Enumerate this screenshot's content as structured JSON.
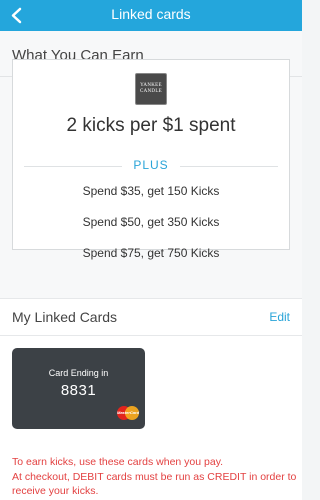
{
  "header": {
    "title": "Linked cards",
    "back_icon": "chevron-left-icon"
  },
  "earn": {
    "heading": "What You Can Earn",
    "merchant_logo_text": "YANKEE\nCANDLE",
    "rate": "2 kicks per $1 spent",
    "plus_label": "PLUS",
    "tiers": [
      "Spend $35, get 150 Kicks",
      "Spend $50, get 350 Kicks",
      "Spend $75, get 750 Kicks"
    ]
  },
  "linked_cards": {
    "heading": "My Linked Cards",
    "edit_label": "Edit",
    "cards": [
      {
        "label": "Card Ending in",
        "last4": "8831",
        "brand_icon": "mastercard-icon",
        "brand_text": "MasterCard"
      }
    ]
  },
  "notes": {
    "line1": "To earn kicks, use these cards when you pay.",
    "line2": "At checkout, DEBIT cards must be run as CREDIT in order to receive your kicks."
  },
  "colors": {
    "accent": "#24a6dc",
    "note_red": "#e34141",
    "card_bg": "#3c4146"
  }
}
